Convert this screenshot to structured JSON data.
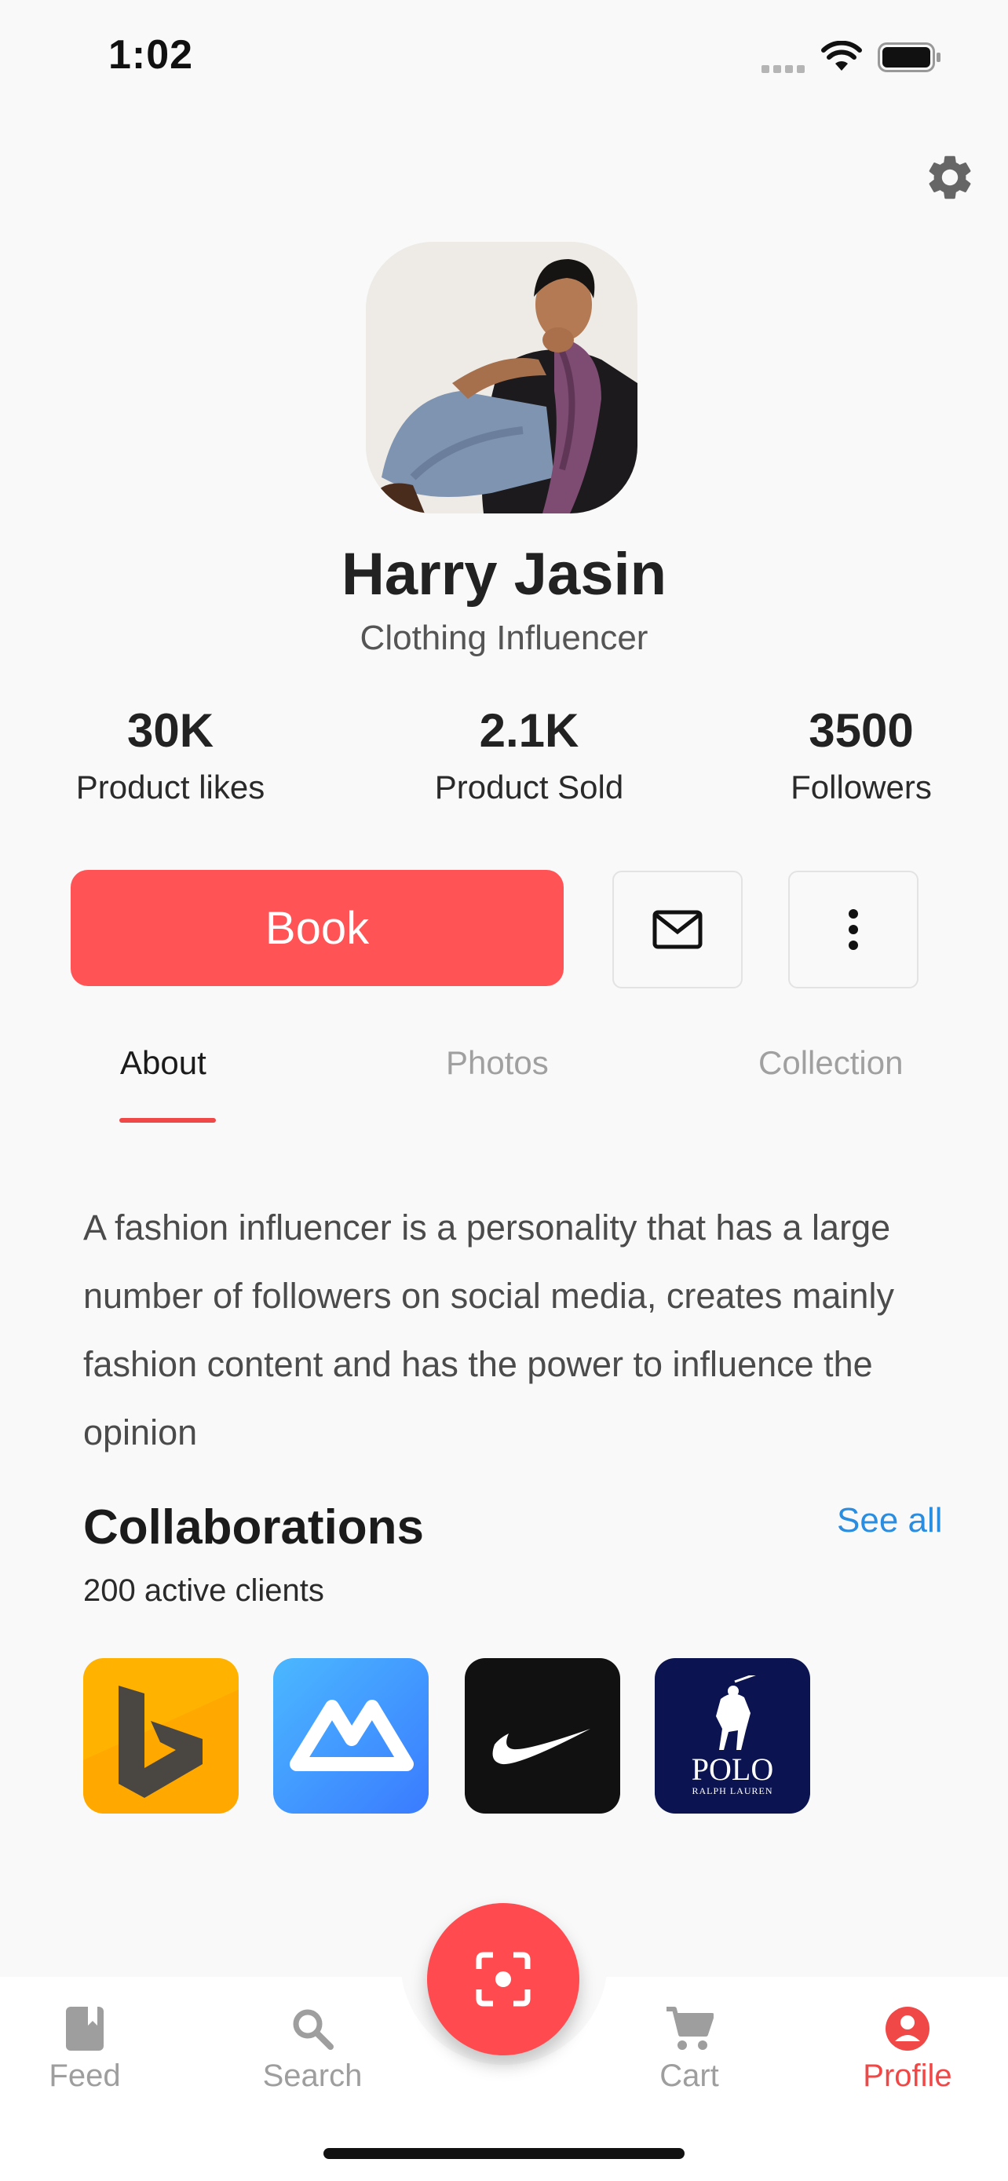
{
  "status_bar": {
    "time": "1:02"
  },
  "profile": {
    "name": "Harry Jasin",
    "role": "Clothing Influencer"
  },
  "stats": [
    {
      "value": "30K",
      "label": "Product likes"
    },
    {
      "value": "2.1K",
      "label": "Product Sold"
    },
    {
      "value": "3500",
      "label": "Followers"
    }
  ],
  "actions": {
    "book_label": "Book"
  },
  "tabs": [
    {
      "label": "About",
      "active": true
    },
    {
      "label": "Photos",
      "active": false
    },
    {
      "label": "Collection",
      "active": false
    }
  ],
  "about": {
    "text": "A fashion influencer is a personality that has a large number of followers on social media, creates mainly fashion content and has the power to influence the opinion"
  },
  "collaborations": {
    "title": "Collaborations",
    "see_all": "See all",
    "subtitle": "200 active clients",
    "brands": [
      {
        "name": "bing-logo",
        "color": "#ffb300"
      },
      {
        "name": "capcut-logo",
        "color": "#3d8bff"
      },
      {
        "name": "nike-logo",
        "color": "#111111"
      },
      {
        "name": "polo-logo",
        "color": "#0b1450",
        "text": "POLO",
        "subtext": "RALPH LAUREN"
      }
    ]
  },
  "bottom_nav": [
    {
      "label": "Feed",
      "icon": "book-icon",
      "active": false
    },
    {
      "label": "Search",
      "icon": "search-icon",
      "active": false
    },
    {
      "label": "Cart",
      "icon": "cart-icon",
      "active": false
    },
    {
      "label": "Profile",
      "icon": "profile-icon",
      "active": true
    }
  ],
  "colors": {
    "accent": "#ff5356",
    "link": "#2a8de0"
  }
}
